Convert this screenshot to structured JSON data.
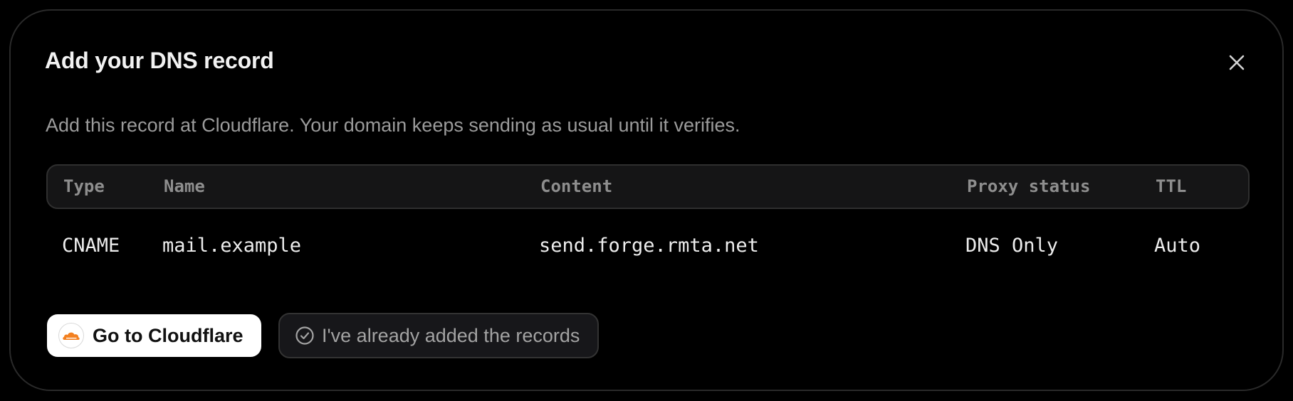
{
  "dialog": {
    "title": "Add your DNS record",
    "subtitle": "Add this record at Cloudflare. Your domain keeps sending as usual until it verifies.",
    "close_icon": "close-icon"
  },
  "table": {
    "columns": [
      "Type",
      "Name",
      "Content",
      "Proxy status",
      "TTL"
    ],
    "rows": [
      [
        "CNAME",
        "mail.example",
        "send.forge.rmta.net",
        "DNS Only",
        "Auto"
      ]
    ]
  },
  "actions": {
    "primary": {
      "label": "Go to Cloudflare",
      "icon": "cloudflare-logo-icon"
    },
    "secondary": {
      "label": "I've already added the records",
      "icon": "check-circle-icon"
    }
  },
  "colors": {
    "background": "#000000",
    "border": "#2a2a2a",
    "cloudflare_orange": "#f38020",
    "primary_button": "#ffffff"
  }
}
